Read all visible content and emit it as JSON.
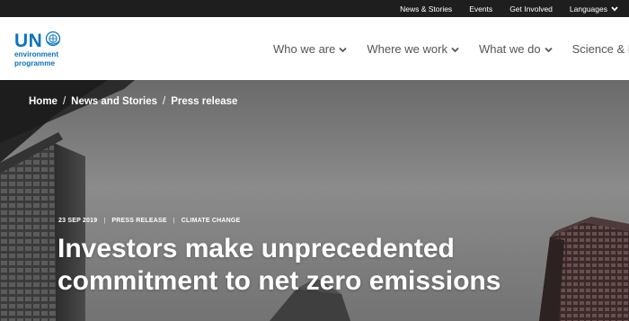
{
  "topbar": {
    "links": [
      "News & Stories",
      "Events",
      "Get Involved"
    ],
    "languages_label": "Languages"
  },
  "logo": {
    "mark": "UN",
    "line1": "environment",
    "line2": "programme",
    "emblem_icon": "un-emblem-icon"
  },
  "nav": {
    "items": [
      "Who we are",
      "Where we work",
      "What we do",
      "Science & Data"
    ]
  },
  "breadcrumb": {
    "items": [
      "Home",
      "News and Stories",
      "Press release"
    ],
    "separator": "/"
  },
  "article": {
    "date": "23 SEP 2019",
    "type": "PRESS RELEASE",
    "topic": "CLIMATE CHANGE",
    "meta_separator": "|",
    "title": "Investors make unprecedented commitment to net zero emissions"
  },
  "colors": {
    "topbar_bg": "#1e1e1e",
    "brand_blue": "#0a73c0",
    "nav_text": "#555555"
  }
}
